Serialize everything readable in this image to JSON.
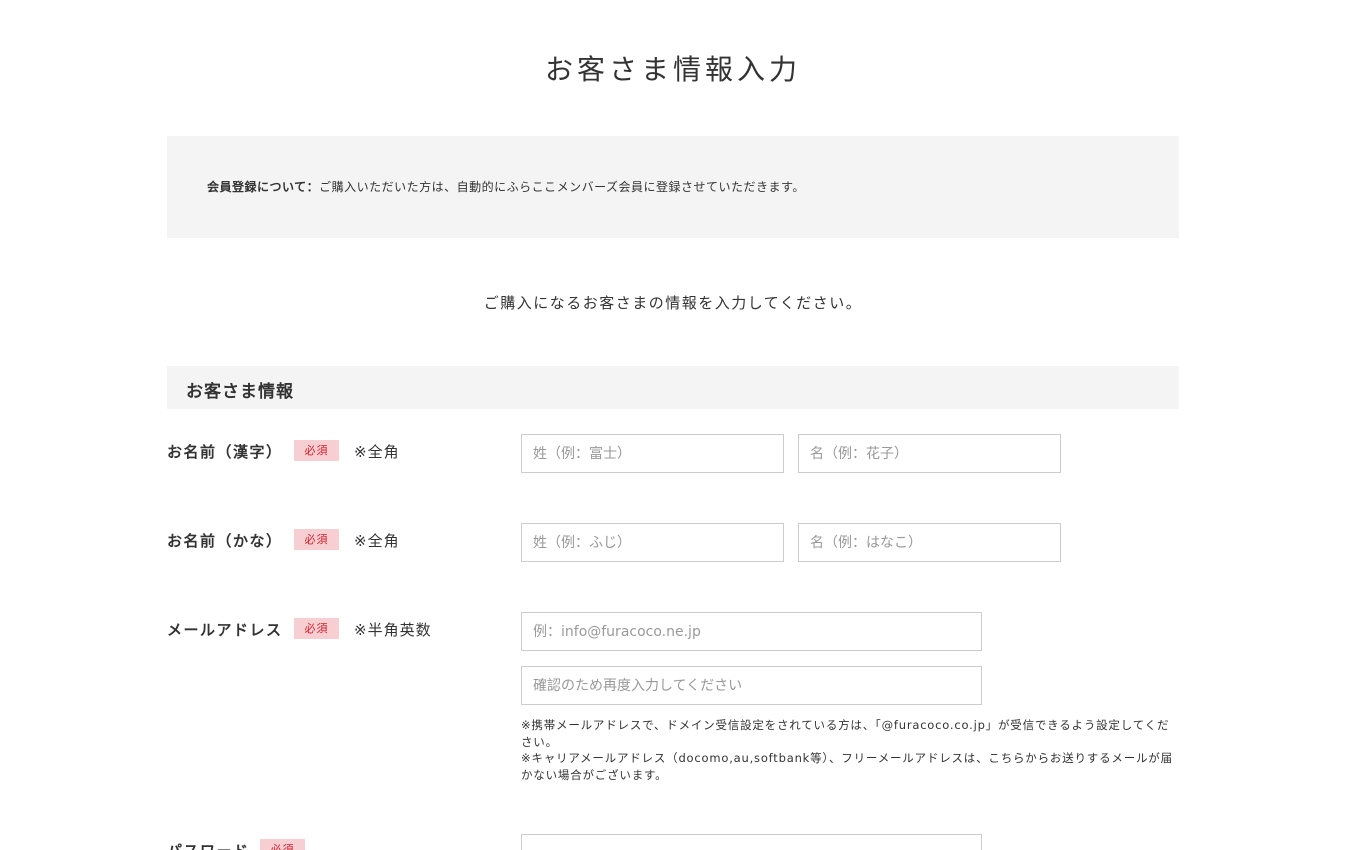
{
  "page": {
    "title": "お客さま情報入力"
  },
  "notice": {
    "label": "会員登録について：",
    "text": "ご購入いただいた方は、自動的にふらここメンバーズ会員に登録させていただきます。"
  },
  "lead": "ご購入になるお客さまの情報を入力してください。",
  "section": {
    "title": "お客さま情報"
  },
  "fields": {
    "name_kanji": {
      "label": "お名前（漢字）",
      "badge": "必須",
      "hint": "※全角",
      "last_placeholder": "姓（例：富士）",
      "first_placeholder": "名（例：花子）",
      "last_value": "",
      "first_value": ""
    },
    "name_kana": {
      "label": "お名前（かな）",
      "badge": "必須",
      "hint": "※全角",
      "last_placeholder": "姓（例：ふじ）",
      "first_placeholder": "名（例：はなこ）",
      "last_value": "",
      "first_value": ""
    },
    "email": {
      "label": "メールアドレス",
      "badge": "必須",
      "hint": "※半角英数",
      "placeholder": "例：info@furacoco.ne.jp",
      "confirm_placeholder": "確認のため再度入力してください",
      "value": "",
      "confirm_value": "",
      "note_1": "※携帯メールアドレスで、ドメイン受信設定をされている方は、「@furacoco.co.jp」が受信できるよう設定してください。",
      "note_2": "※キャリアメールアドレス（docomo,au,softbank等）、フリーメールアドレスは、こちらからお送りするメールが届かない場合がございます。"
    },
    "password": {
      "label": "パスワード",
      "badge": "必須",
      "value": ""
    }
  },
  "colors": {
    "badge_bg": "#f7cfd2",
    "badge_text": "#d0202e",
    "panel_bg": "#f4f4f4",
    "input_border": "#cccccc"
  }
}
